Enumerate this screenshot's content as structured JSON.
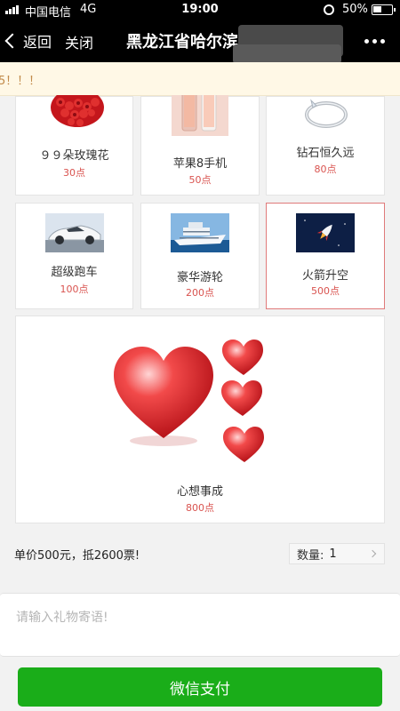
{
  "status_bar": {
    "carrier": "中国电信",
    "network": "4G",
    "time": "19:00",
    "battery": "50%"
  },
  "nav": {
    "back_label": "返回",
    "close_label": "关闭",
    "title": "黑龙江省哈尔滨"
  },
  "notice": {
    "text": "5！！！"
  },
  "gifts": [
    {
      "name": "９９朵玫瑰花",
      "price": "30点",
      "icon": "roses-icon"
    },
    {
      "name": "苹果8手机",
      "price": "50点",
      "icon": "phone-icon"
    },
    {
      "name": "钻石恒久远",
      "price": "80点",
      "icon": "ring-icon"
    },
    {
      "name": "超级跑车",
      "price": "100点",
      "icon": "sports-car-icon"
    },
    {
      "name": "豪华游轮",
      "price": "200点",
      "icon": "cruise-ship-icon"
    },
    {
      "name": "火箭升空",
      "price": "500点",
      "icon": "rocket-icon",
      "selected": true
    }
  ],
  "wish_gift": {
    "name": "心想事成",
    "price": "800点",
    "icon": "hearts-icon"
  },
  "purchase": {
    "unit_price_text": "单价500元，抵2600票!",
    "quantity_label": "数量:",
    "quantity_value": "1"
  },
  "message": {
    "placeholder": "请输入礼物寄语!"
  },
  "pay_button_label": "微信支付",
  "colors": {
    "accent_green": "#1aad19",
    "price_red": "#d9534f",
    "notice_bg": "#fff8e6",
    "nav_bg": "#000000"
  }
}
